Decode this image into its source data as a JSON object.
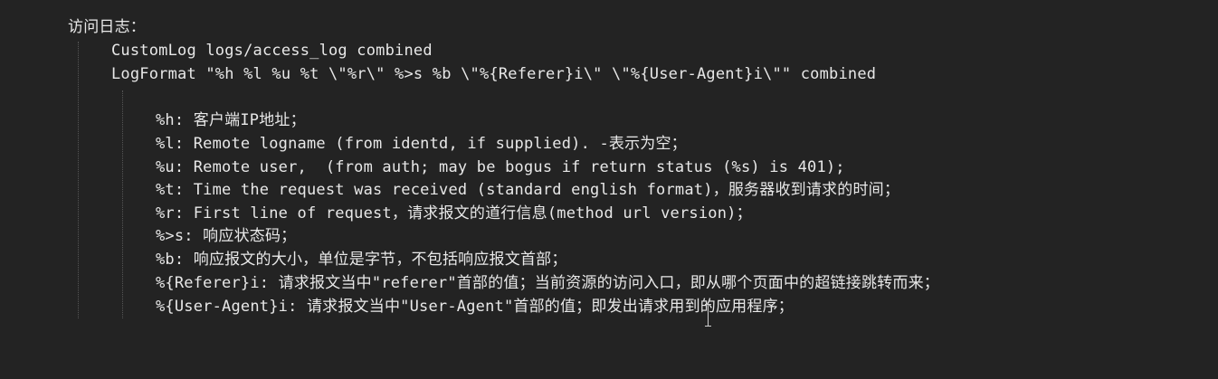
{
  "document": {
    "heading": "访问日志：",
    "directives": {
      "custom_log": "CustomLog logs/access_log combined",
      "log_format": "LogFormat \"%h %l %u %t \\\"%r\\\" %>s %b \\\"%{Referer}i\\\" \\\"%{User-Agent}i\\\"\" combined"
    },
    "definitions": [
      "%h: 客户端IP地址；",
      "%l: Remote logname (from identd, if supplied). -表示为空；",
      "%u: Remote user,  (from auth; may be bogus if return status (%s) is 401);",
      "%t: Time the request was received (standard english format)，服务器收到请求的时间；",
      "%r: First line of request，请求报文的道行信息(method url version)；",
      "%>s: 响应状态码；",
      "%b: 响应报文的大小，单位是字节，不包括响应报文首部；",
      "%{Referer}i: 请求报文当中\"referer\"首部的值；当前资源的访问入口，即从哪个页面中的超链接跳转而来；",
      "%{User-Agent}i: 请求报文当中\"User-Agent\"首部的值；即发出请求用到的应用程序；"
    ]
  },
  "colors": {
    "background": "#232323",
    "text": "#e8e8e8"
  },
  "icons": {
    "cursor": "text-cursor-icon"
  }
}
